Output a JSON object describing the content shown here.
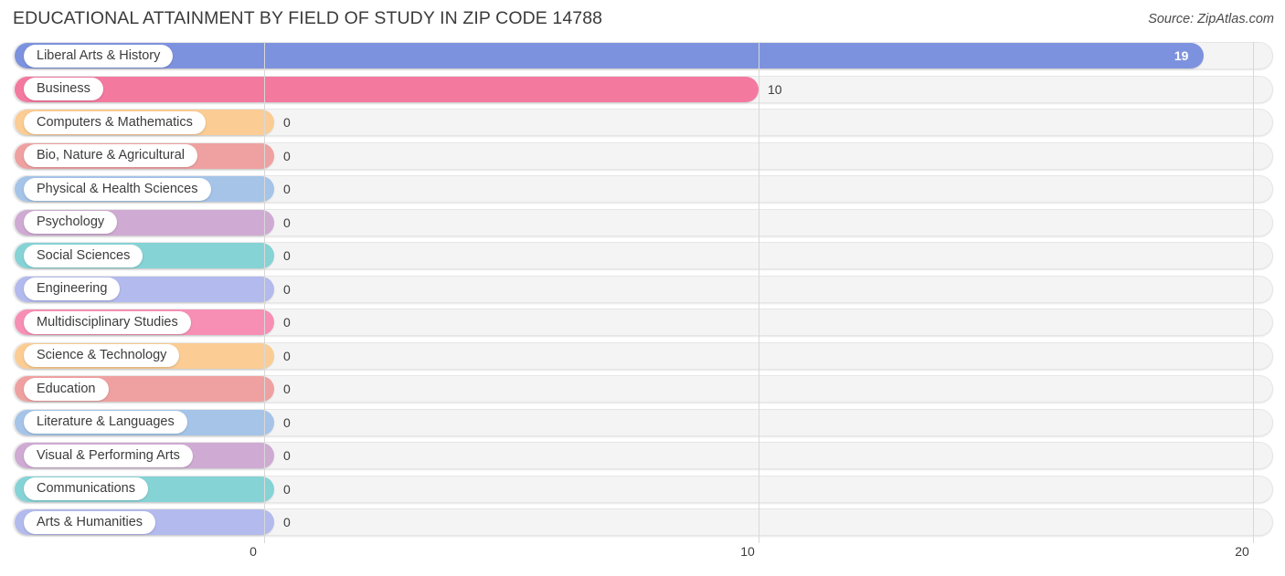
{
  "header": {
    "title": "EDUCATIONAL ATTAINMENT BY FIELD OF STUDY IN ZIP CODE 14788",
    "source": "Source: ZipAtlas.com"
  },
  "chart_data": {
    "type": "bar",
    "orientation": "horizontal",
    "title": "EDUCATIONAL ATTAINMENT BY FIELD OF STUDY IN ZIP CODE 14788",
    "xlabel": "",
    "ylabel": "",
    "xlim": [
      0,
      20
    ],
    "grid": true,
    "legend": "none",
    "xticks": [
      "0",
      "10",
      "20"
    ],
    "xtick_values": [
      0,
      10,
      20
    ],
    "categories": [
      "Liberal Arts & History",
      "Business",
      "Computers & Mathematics",
      "Bio, Nature & Agricultural",
      "Physical & Health Sciences",
      "Psychology",
      "Social Sciences",
      "Engineering",
      "Multidisciplinary Studies",
      "Science & Technology",
      "Education",
      "Literature & Languages",
      "Visual & Performing Arts",
      "Communications",
      "Arts & Humanities"
    ],
    "values": [
      19,
      10,
      0,
      0,
      0,
      0,
      0,
      0,
      0,
      0,
      0,
      0,
      0,
      0,
      0
    ],
    "value_labels": [
      "19",
      "10",
      "0",
      "0",
      "0",
      "0",
      "0",
      "0",
      "0",
      "0",
      "0",
      "0",
      "0",
      "0",
      "0"
    ],
    "bar_colors": [
      "#7d92de",
      "#f4799f",
      "#fbcc93",
      "#efa1a1",
      "#a5c4e8",
      "#cfaad3",
      "#86d3d6",
      "#b3baed",
      "#f78fb5",
      "#fbcc93",
      "#efa1a1",
      "#a5c4e8",
      "#cfaad3",
      "#86d3d6",
      "#b3baed"
    ]
  }
}
